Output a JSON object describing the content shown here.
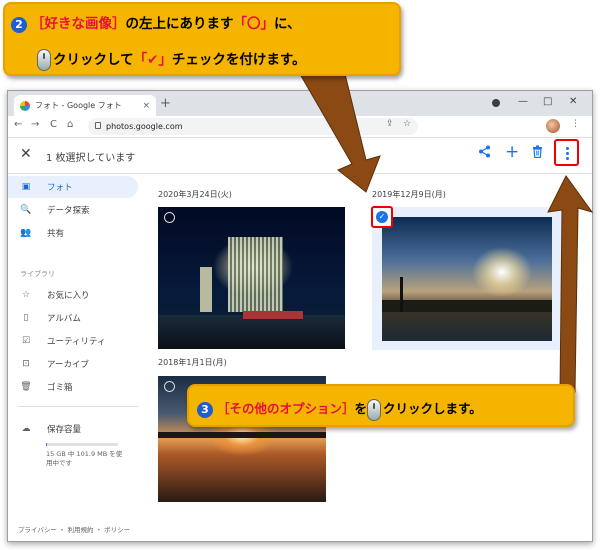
{
  "browser": {
    "tab_title": "フォト - Google フォト",
    "tab_close": "×",
    "new_tab": "+",
    "minimize": "—",
    "maximize": "□",
    "close": "✕",
    "back": "←",
    "forward": "→",
    "reload": "C",
    "home": "⌂",
    "url": "photos.google.com",
    "menu": "⋮"
  },
  "appbar": {
    "close": "✕",
    "selection_text": "1 枚選択しています",
    "share": "<",
    "add": "+",
    "trash": "🗑"
  },
  "sidebar": {
    "items": [
      {
        "label": "フォト",
        "icon": "photo-icon",
        "glyph": "▣"
      },
      {
        "label": "データ探索",
        "icon": "search-icon",
        "glyph": "🔍"
      },
      {
        "label": "共有",
        "icon": "people-icon",
        "glyph": "👥"
      }
    ],
    "library_header": "ライブラリ",
    "library_items": [
      {
        "label": "お気に入り",
        "icon": "star-icon",
        "glyph": "☆"
      },
      {
        "label": "アルバム",
        "icon": "album-icon",
        "glyph": "▯"
      },
      {
        "label": "ユーティリティ",
        "icon": "utilities-icon",
        "glyph": "☑"
      },
      {
        "label": "アーカイブ",
        "icon": "archive-icon",
        "glyph": "⊡"
      },
      {
        "label": "ゴミ箱",
        "icon": "trash-icon",
        "glyph": "🗑"
      }
    ],
    "storage_label": "保存容量",
    "storage_glyph": "☁",
    "storage_detail": "15 GB 中 101.9 MB を使用中です",
    "storage_fraction": 0.01,
    "footer": "プライバシー ・ 利用規約 ・ ポリシー"
  },
  "photos": {
    "date1": "2020年3月24日(火)",
    "date2": "2019年12月9日(月)",
    "date3": "2018年1月1日(月)",
    "checkmark": "✓"
  },
  "callouts": {
    "c1_num": "2",
    "c1_bracket_text": "［好きな画像］",
    "c1_rest": "の左上にあります",
    "c1_circle": "「〇」",
    "c1_rest2": "に、",
    "c1_click": "クリック",
    "c1_shite": "して",
    "c1_check": "「✔」",
    "c1_end": "チェックを付けます。",
    "c2_num": "3",
    "c2_bracket_text": "［その他のオプション］",
    "c2_wo": "を",
    "c2_click": "クリック",
    "c2_end": "します。"
  },
  "colors": {
    "callout": "#f5b400",
    "arrow": "#8b4a14",
    "highlight": "#e00000",
    "accent": "#1a73e8"
  }
}
